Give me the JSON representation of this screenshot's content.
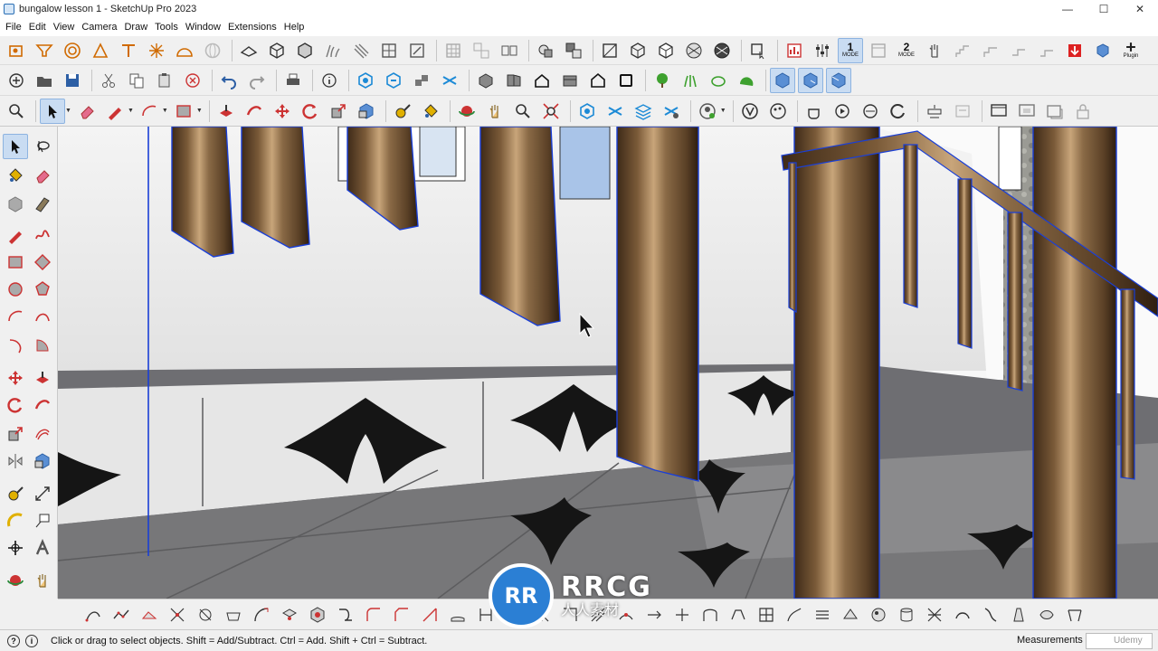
{
  "window": {
    "title": "bungalow lesson 1 - SketchUp Pro 2023",
    "controls": [
      "—",
      "☐",
      "✕"
    ]
  },
  "menu": [
    "File",
    "Edit",
    "View",
    "Camera",
    "Draw",
    "Tools",
    "Window",
    "Extensions",
    "Help"
  ],
  "toolbar": {
    "mode1_num": "1",
    "mode1_label": "MODE",
    "mode2_num": "2",
    "mode2_label": "MODE",
    "plugin_label": "Plugin"
  },
  "status": {
    "text": "Click or drag to select objects. Shift = Add/Subtract. Ctrl = Add. Shift + Ctrl = Subtract.",
    "measurements_label": "Measurements",
    "measurements_value": "Udemy"
  },
  "watermark": {
    "logo": "RR",
    "name": "RRCG",
    "subtitle": "人人素材"
  },
  "colors": {
    "selection_blue": "#1a3fd6",
    "active_tool_bg": "#c9dcf2",
    "wood_dark": "#5a4026",
    "wood_light": "#c09a6a"
  }
}
